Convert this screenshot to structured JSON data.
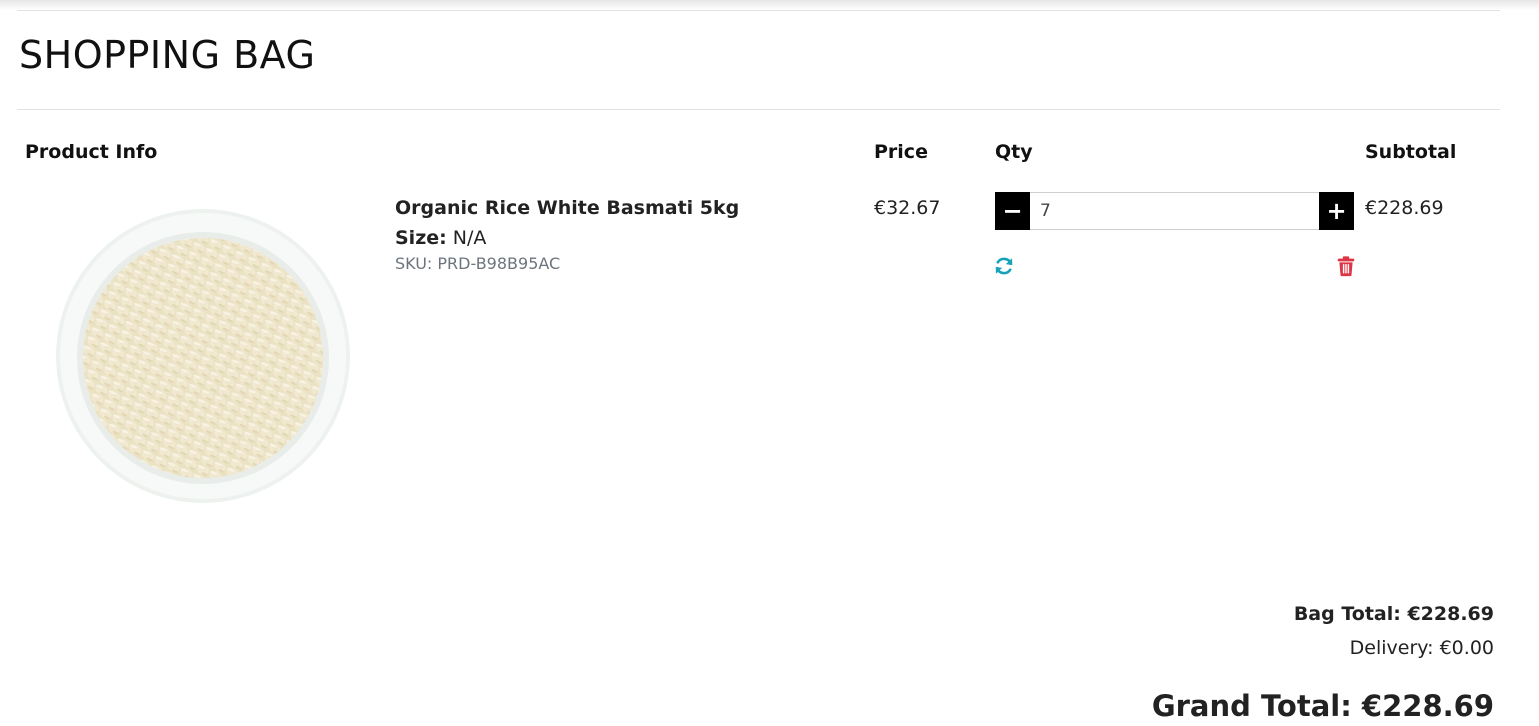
{
  "page": {
    "title": "SHOPPING BAG"
  },
  "table": {
    "headers": {
      "product_info": "Product Info",
      "price": "Price",
      "qty": "Qty",
      "subtotal": "Subtotal"
    },
    "items": [
      {
        "name": "Organic Rice White Basmati 5kg",
        "size_label": "Size:",
        "size_value": "N/A",
        "sku": "SKU: PRD-B98B95AC",
        "price": "€32.67",
        "quantity": "7",
        "subtotal": "€228.69",
        "image_icon": "rice-bowl-image"
      }
    ]
  },
  "actions": {
    "decrement_symbol": "−",
    "increment_symbol": "+",
    "update_icon": "refresh-icon",
    "remove_icon": "trash-icon"
  },
  "summary": {
    "bag_total": "Bag Total: €228.69",
    "delivery": "Delivery: €0.00",
    "grand_total": "Grand Total: €228.69"
  },
  "colors": {
    "update_icon": "#17a2b8",
    "remove_icon": "#dc3545",
    "qty_button_bg": "#000000"
  }
}
